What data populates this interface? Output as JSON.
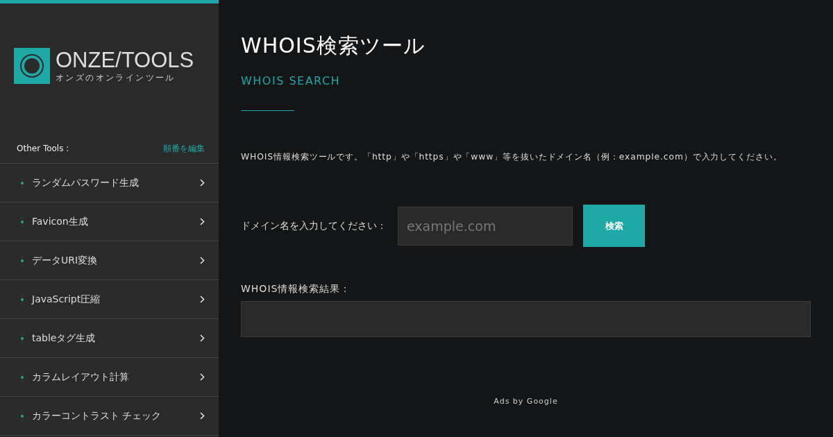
{
  "sidebar": {
    "logo": {
      "name": "ONZE/TOOLS",
      "tagline": "オンズのオンラインツール"
    },
    "heading": "Other Tools :",
    "edit_link": "順番を編集",
    "items": [
      {
        "label": "ランダムパスワード生成"
      },
      {
        "label": "Favicon生成"
      },
      {
        "label": "データURI変換"
      },
      {
        "label": "JavaScript圧縮"
      },
      {
        "label": "tableタグ生成"
      },
      {
        "label": "カラムレイアウト計算"
      },
      {
        "label": "カラーコントラスト チェック"
      }
    ]
  },
  "main": {
    "title": "WHOIS検索ツール",
    "subtitle": "WHOIS SEARCH",
    "description": "WHOIS情報検索ツールです。「http」や「https」や「www」等を抜いたドメイン名（例：example.com）で入力してください。",
    "domain_label": "ドメイン名を入力してください：",
    "domain_field": {
      "placeholder": "example.com"
    },
    "search_button": "検索",
    "result_label": "WHOIS情報検索結果：",
    "ads": "Ads by Google"
  }
}
